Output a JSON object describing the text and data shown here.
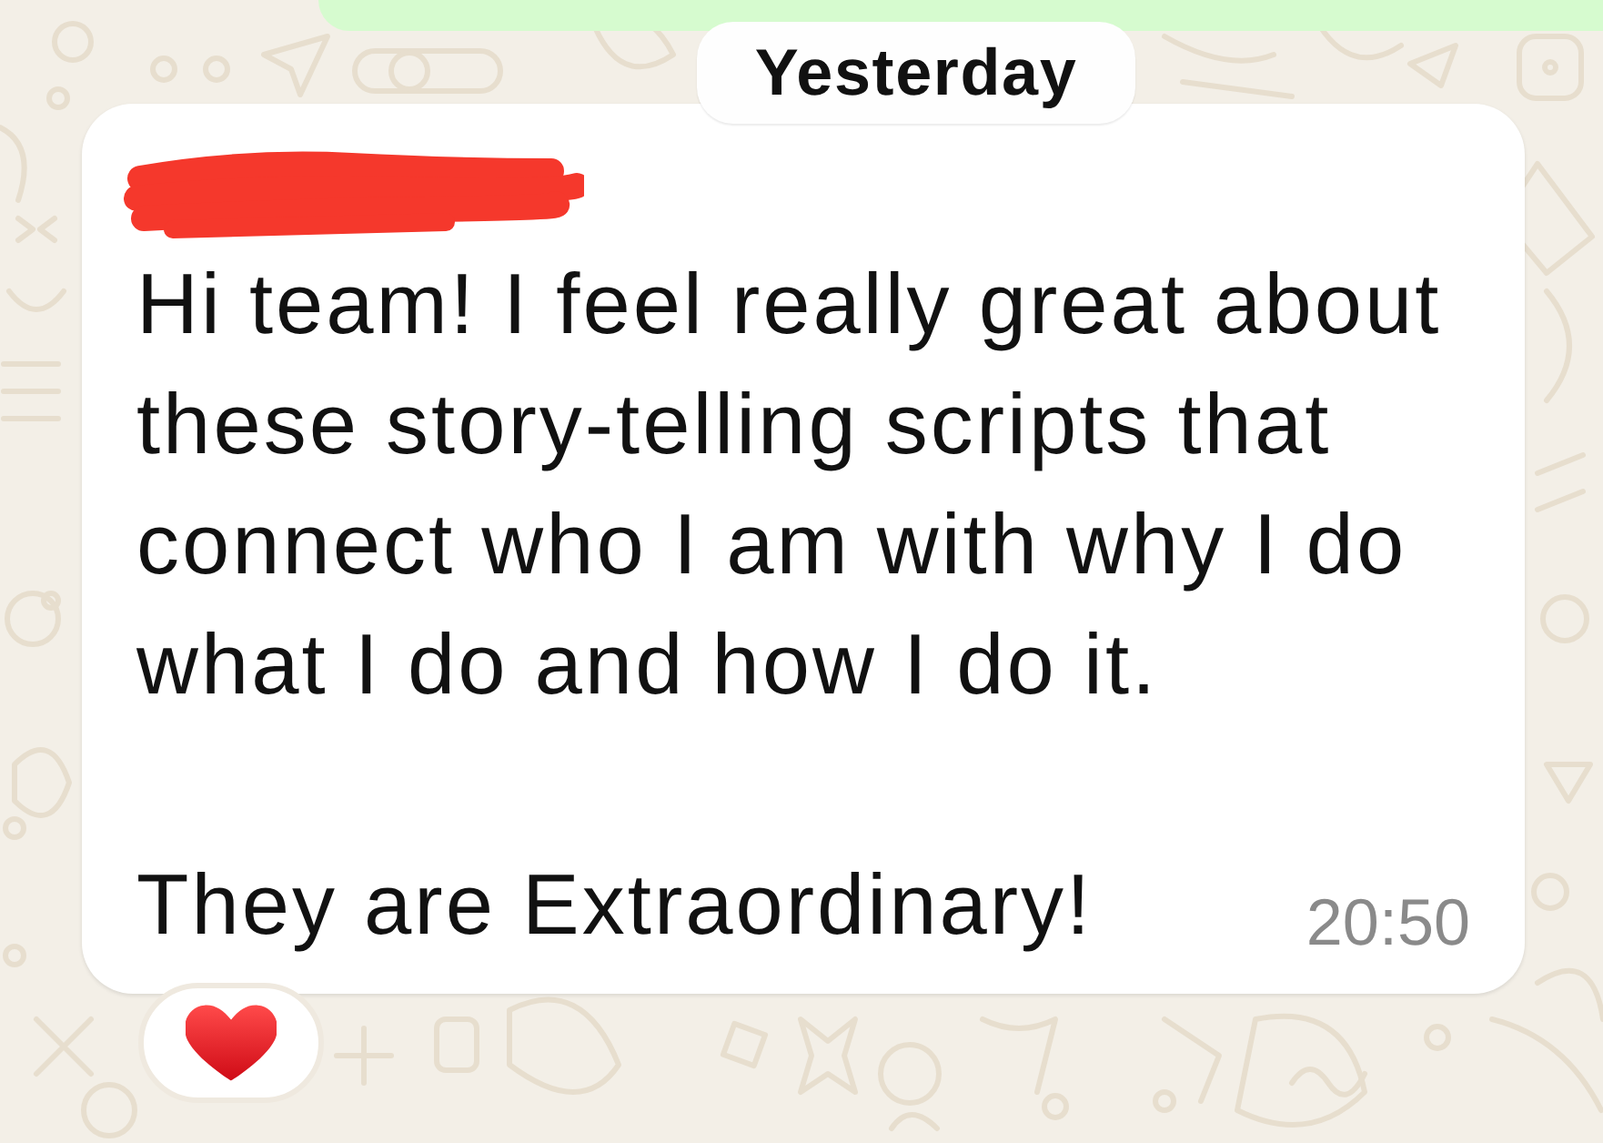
{
  "date_divider": {
    "label": "Yesterday"
  },
  "message": {
    "sender_redacted": true,
    "paragraphs": [
      "Hi team! I feel really great about these story-telling scripts that connect who I am with why I do what I do and how I do it.",
      "They are Extraordinary!"
    ],
    "time": "20:50",
    "reactions": [
      {
        "kind": "heart"
      }
    ]
  }
}
